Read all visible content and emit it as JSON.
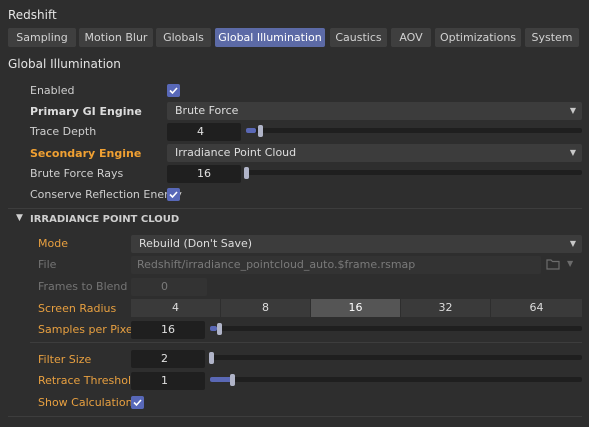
{
  "app": {
    "title": "Redshift"
  },
  "tabs": [
    {
      "label": "Sampling",
      "active": false
    },
    {
      "label": "Motion Blur",
      "active": false
    },
    {
      "label": "Globals",
      "active": false
    },
    {
      "label": "Global Illumination",
      "active": true
    },
    {
      "label": "Caustics",
      "active": false
    },
    {
      "label": "AOV",
      "active": false
    },
    {
      "label": "Optimizations",
      "active": false
    },
    {
      "label": "System",
      "active": false
    }
  ],
  "section": {
    "title": "Global Illumination"
  },
  "gi": {
    "enabled": {
      "label": "Enabled",
      "checked": true
    },
    "primary": {
      "label": "Primary GI Engine",
      "value": "Brute Force"
    },
    "trace_depth": {
      "label": "Trace Depth",
      "value": "4",
      "fraction": 0.03
    },
    "secondary": {
      "label": "Secondary Engine",
      "value": "Irradiance Point Cloud"
    },
    "brute_rays": {
      "label": "Brute Force Rays",
      "value": "16",
      "fraction": 0.0
    },
    "conserve": {
      "label": "Conserve Reflection Energy",
      "checked": true
    }
  },
  "ipc": {
    "title": "IRRADIANCE POINT CLOUD",
    "mode": {
      "label": "Mode",
      "value": "Rebuild (Don't Save)"
    },
    "file": {
      "label": "File",
      "value": "Redshift/irradiance_pointcloud_auto.$frame.rsmap"
    },
    "frames": {
      "label": "Frames to Blend",
      "value": "0"
    },
    "screen_radius": {
      "label": "Screen Radius",
      "options": [
        "4",
        "8",
        "16",
        "32",
        "64"
      ],
      "selected": "16"
    },
    "samples": {
      "label": "Samples per Pixel",
      "value": "16",
      "fraction": 0.02
    },
    "filter_size": {
      "label": "Filter Size",
      "value": "2",
      "fraction": 0.0
    },
    "retrace": {
      "label": "Retrace Threshold",
      "value": "1",
      "fraction": 0.06
    },
    "show_calc": {
      "label": "Show Calculation",
      "checked": true
    }
  },
  "colors": {
    "accent": "#5c6aa6",
    "orange_label": "#e8a040",
    "background": "#2e2e2e"
  },
  "icons": {
    "checkbox": "checkmark-icon",
    "dropdown": "chevron-down-icon",
    "folder": "folder-icon",
    "collapse": "chevron-down-icon"
  }
}
